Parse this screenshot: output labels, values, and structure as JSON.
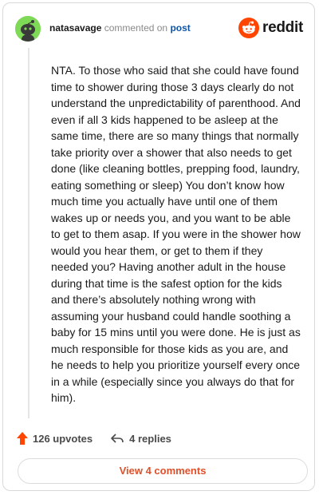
{
  "comment": {
    "username": "natasavage",
    "action_text": "commented on",
    "post_link": "post",
    "logo_text": "reddit",
    "body": "NTA. To those who said that she could have found time to shower during those 3 days clearly do not understand the unpredictability of parenthood. And even if all 3 kids happened to be asleep at the same time, there are so many things that normally take priority over a shower that also needs to get done (like cleaning bottles, prepping food, laundry, eating something or sleep) You don’t know how much time you actually have until one of them wakes up or needs you, and you want to be able to get to them asap. If you were in the shower how would you hear them, or get to them if they needed you? Having another adult in the house during that time is the safest option for the kids and there’s absolutely nothing wrong with assuming your husband could handle soothing a baby for 15 mins until you were done. He is just as much responsible for those kids as you are, and he needs to help you prioritize yourself every once in a while (especially since you always do that for him).",
    "upvotes": "126 upvotes",
    "replies": "4 replies",
    "view_comments": "View 4 comments"
  },
  "icons": {
    "avatar": "snoo-avatar-icon",
    "logo": "reddit-logo-icon",
    "upvote": "upvote-arrow-icon",
    "reply": "reply-arrow-icon"
  },
  "colors": {
    "avatar_bg": "#7ed957",
    "upvote": "#ff4500",
    "link": "#0a55a8",
    "view_button_text": "#e0502a"
  }
}
